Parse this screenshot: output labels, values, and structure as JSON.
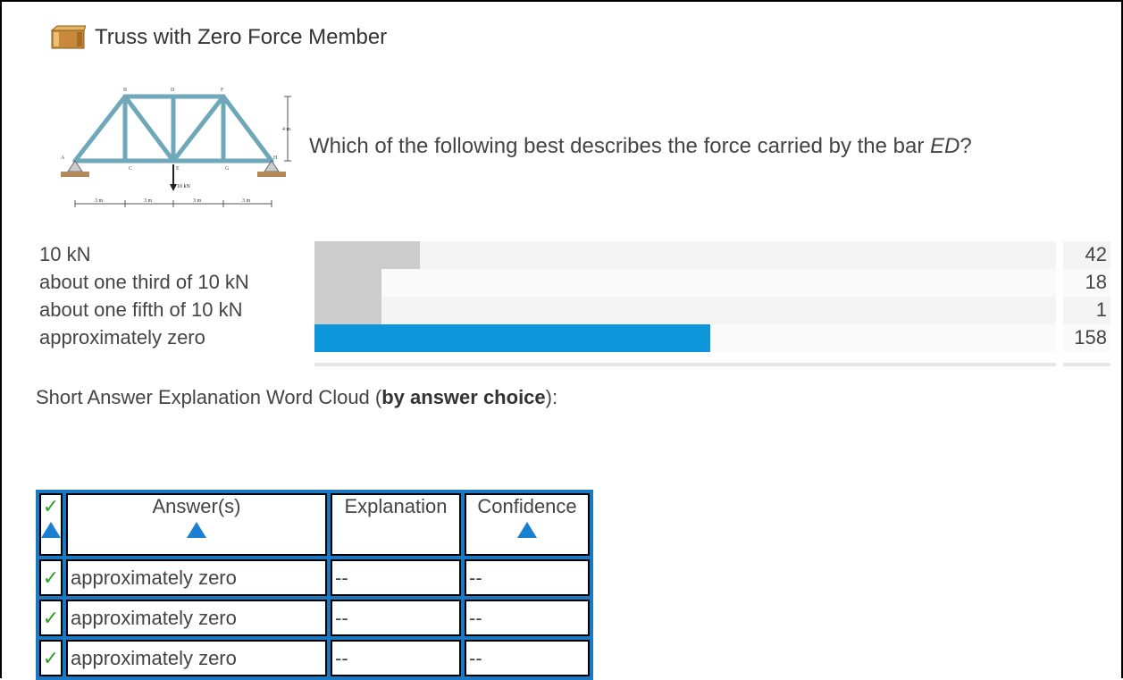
{
  "title": "Truss with Zero Force Member",
  "question": {
    "prefix": "Which of the following best describes the force carried by the bar ",
    "bar": "ED",
    "suffix": "?"
  },
  "figure": {
    "joints": [
      "A",
      "B",
      "C",
      "D",
      "E",
      "F",
      "G",
      "H"
    ],
    "height_label": "4 m",
    "load_label": "10 kN",
    "spans": [
      "3 m",
      "3 m",
      "3 m",
      "3 m"
    ]
  },
  "answers": [
    {
      "label": "10 kN",
      "count": "42",
      "value": 42,
      "correct": false
    },
    {
      "label": "about one third of 10 kN",
      "count": "18",
      "value": 18,
      "correct": false
    },
    {
      "label": "about one fifth of 10 kN",
      "count": "1",
      "value": 1,
      "correct": false
    },
    {
      "label": "approximately zero",
      "count": "158",
      "value": 158,
      "correct": true
    }
  ],
  "wordcloud": {
    "prefix": "Short Answer Explanation Word Cloud (",
    "bold": "by answer choice",
    "suffix": "):"
  },
  "table": {
    "headers": {
      "answer": "Answer(s)",
      "explanation": "Explanation",
      "confidence": "Confidence"
    },
    "rows": [
      {
        "check": "✓",
        "answer": "approximately zero",
        "explanation": "--",
        "confidence": "--"
      },
      {
        "check": "✓",
        "answer": "approximately zero",
        "explanation": "--",
        "confidence": "--"
      },
      {
        "check": "✓",
        "answer": "approximately zero",
        "explanation": "--",
        "confidence": "--"
      }
    ]
  },
  "icons": {
    "title_icon": "box-icon",
    "check_icon": "checkmark-icon",
    "sort_icon": "sort-ascending-icon"
  },
  "colors": {
    "correct_bar": "#0d96d9",
    "incorrect_bar": "#cccccc",
    "table_border": "#1b78c2",
    "check": "#2aa02a",
    "sort_triangle": "#1a7fd0"
  }
}
